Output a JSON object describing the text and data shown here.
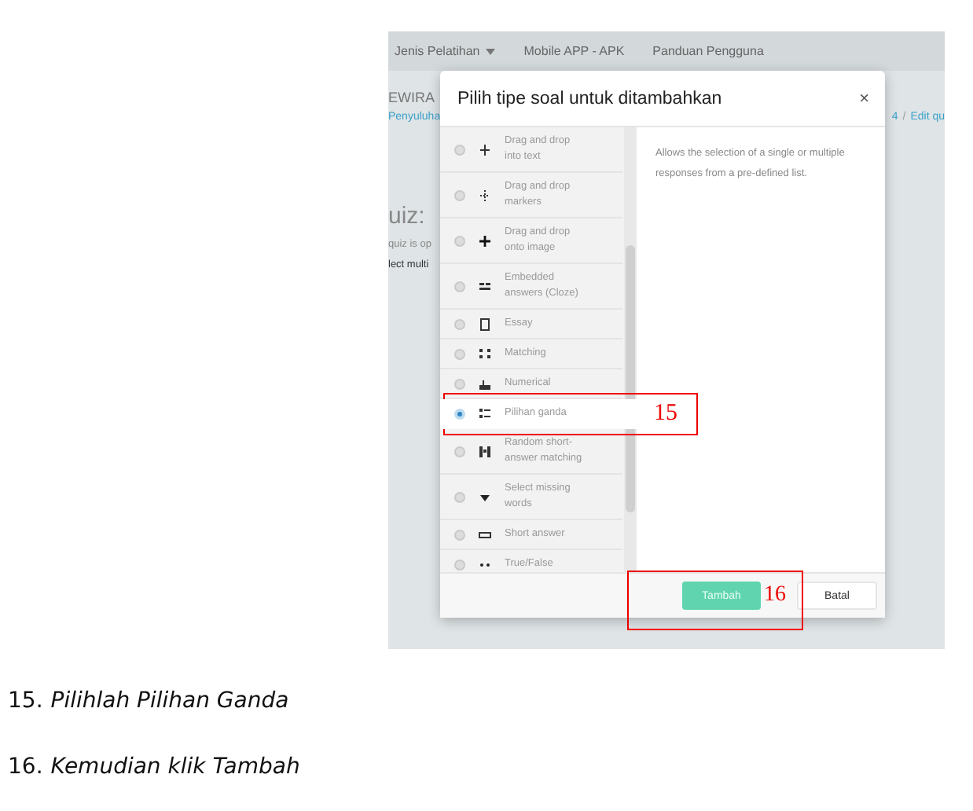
{
  "screenshot": {
    "nav": [
      "Jenis Pelatihan",
      "Mobile APP - APK",
      "Panduan Pengguna"
    ],
    "background_texts": {
      "heading": "EWIRA",
      "link": "Penyuluha",
      "crumb": "4",
      "crumb_sep": "/",
      "crumb_link": "Edit qu",
      "title": "uiz:",
      "note": "quiz is op",
      "select": "lect multi"
    },
    "dialog": {
      "title": "Pilih tipe soal untuk ditambahkan",
      "close": "×",
      "items": [
        {
          "label": "Drag and drop into text",
          "selected": false
        },
        {
          "label": "Drag and drop markers",
          "selected": false
        },
        {
          "label": "Drag and drop onto image",
          "selected": false
        },
        {
          "label": "Embedded answers (Cloze)",
          "selected": false
        },
        {
          "label": "Essay",
          "selected": false
        },
        {
          "label": "Matching",
          "selected": false
        },
        {
          "label": "Numerical",
          "selected": false
        },
        {
          "label": "Pilihan ganda",
          "selected": true
        },
        {
          "label": "Random short-answer matching",
          "selected": false
        },
        {
          "label": "Select missing words",
          "selected": false
        },
        {
          "label": "Short answer",
          "selected": false
        },
        {
          "label": "True/False",
          "selected": false
        }
      ],
      "description": "Allows the selection of a single or multiple responses from a pre-defined list.",
      "buttons": [
        {
          "label": "Tambah",
          "kind": "primary"
        },
        {
          "label": "Batal",
          "kind": "secondary"
        }
      ]
    },
    "annotations": [
      "15",
      "16"
    ]
  },
  "steps": [
    {
      "number": "15.",
      "text": "Pilihlah Pilihan Ganda"
    },
    {
      "number": "16.",
      "text": "Kemudian klik Tambah"
    }
  ]
}
